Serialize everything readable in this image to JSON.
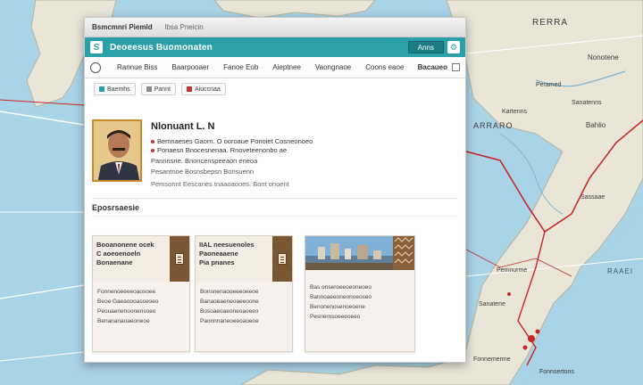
{
  "map": {
    "labels": [
      "RERRA",
      "Nonotene",
      "Peramed",
      "Sanatenns",
      "Kartenns",
      "ARRARO",
      "Bahlio",
      "Sassaae",
      "RAAEI",
      "Sanatene",
      "Pemnurme",
      "Fonnemerme",
      "Fonnsertons"
    ],
    "colors": {
      "sea": "#a9d3e6",
      "land": "#e9e6d8",
      "route": "#c62828"
    }
  },
  "window": {
    "title": "Bsmcmnri Piemld",
    "url": "lbsa Pneicin"
  },
  "header": {
    "logo": "S",
    "app_title": "Deoeesus Buomonaten",
    "button_label": "Anns"
  },
  "nav": {
    "items": [
      "Rannue Biss",
      "Baarpooaer",
      "Fanoe Eob",
      "Aieptnee",
      "Vaongnaoe",
      "Coons eaoe"
    ],
    "right_label": "Bacaueo"
  },
  "toolbar": {
    "buttons": [
      "Baemhs",
      "Pannt",
      "Aiuccnaa"
    ]
  },
  "profile": {
    "name": "Nlonuant L. N",
    "lines": [
      "Bemnaeses Gaorn. O ooroaue Ponoiet Cosneonoeo",
      "Ponaesn Bnocesnenaa. Rnoveteenonbo ae",
      "Pannnsne. Bnoncenspeeaon eneoa",
      "Pesantnoe Bosnsbepsn Bonsuenn",
      "Pemsonnt Eescanes tnaaoaooes. Bont onoent"
    ]
  },
  "section": {
    "title": "Eposrsaesie"
  },
  "cards": [
    {
      "head_lines": [
        "Booanonene ocek",
        "C aoeoenoeln",
        "Bonaenane"
      ],
      "body_lines": [
        "Fonnenoeeeeoaosoee",
        "Beoe Gaeaoooasoeseo",
        "Peouaenenoonensoeo",
        "Benananaoaeoneoe"
      ]
    },
    {
      "head_lines": [
        "IIAL neesuenoles",
        "Paoneaaene",
        "Pia pnanes"
      ],
      "body_lines": [
        "Bonsnenaooeeeoeeoe",
        "Banaoeaeneoaeeoone",
        "Bosoaeoaeoneoaoeeo",
        "Paonnnaneoeeoaoeoe"
      ]
    },
    {
      "body_lines": [
        "Bas onseroeeoeoneoeo",
        "Bannoaeeoneonoeoseo",
        "Benonenosenoeoene",
        "Pesnernsoeeeoeeo"
      ]
    }
  ]
}
